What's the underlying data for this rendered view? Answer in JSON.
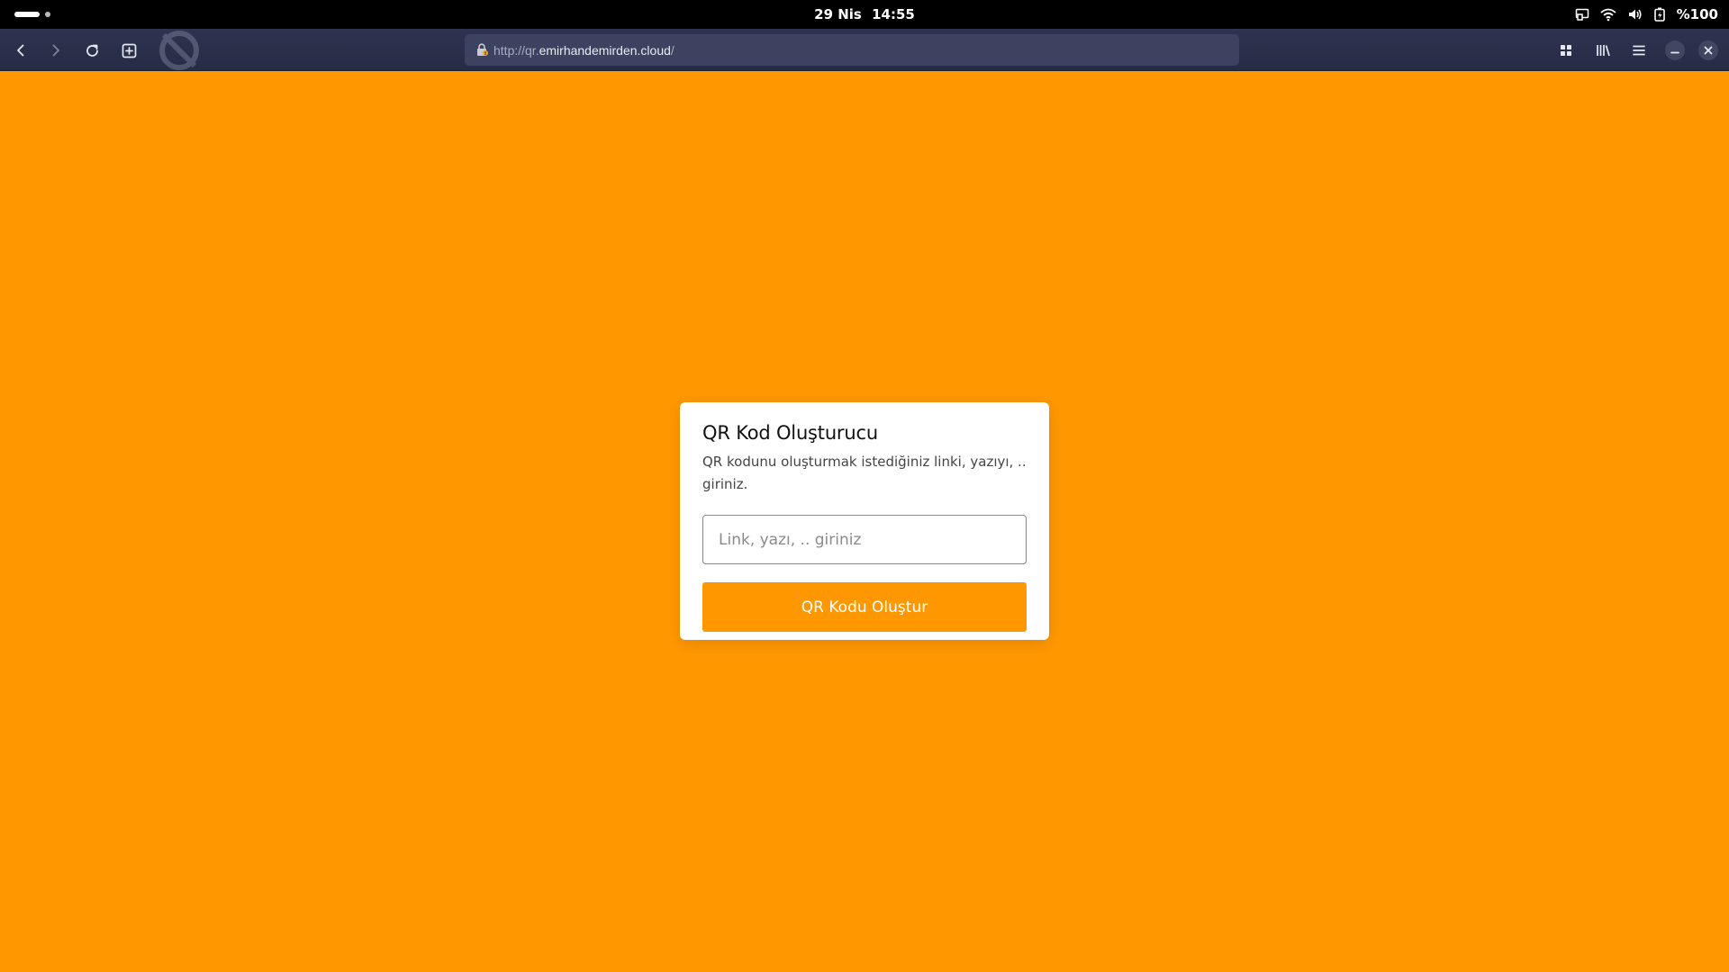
{
  "system_bar": {
    "date": "29 Nis",
    "time": "14:55",
    "battery": "%100"
  },
  "browser": {
    "url_scheme": "http://qr.",
    "url_host": "emirhandemirden.cloud",
    "url_path": "/"
  },
  "page": {
    "background_color": "#ff9800",
    "card": {
      "title": "QR Kod Oluşturucu",
      "description": "QR kodunu oluşturmak istediğiniz linki, yazıyı, .. giriniz.",
      "input_placeholder": "Link, yazı, .. giriniz",
      "input_value": "",
      "button_label": "QR Kodu Oluştur"
    }
  }
}
